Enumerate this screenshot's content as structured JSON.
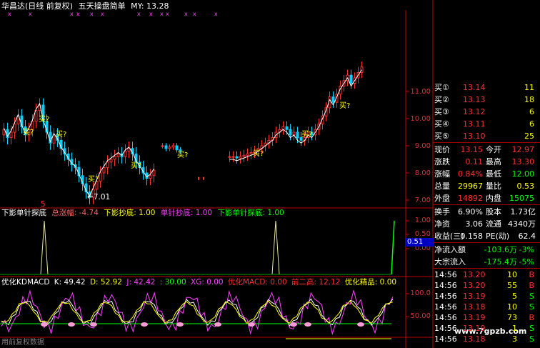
{
  "header": {
    "stock": "华昌达(日线 前复权)",
    "indicator": "五天操盘简单",
    "my": "MY: 13.28"
  },
  "main_axis": [
    "11.00",
    "10.00",
    "9.00",
    "8.00",
    "7.00"
  ],
  "price_labels": {
    "low": "7.01"
  },
  "buy_tags": [
    "买?",
    "买?",
    "买?",
    "买?",
    "买?",
    "买?",
    "买?",
    "买?",
    "买?"
  ],
  "red_marker": "5",
  "panel2": {
    "name": "下影单针探底",
    "zongzhangfu": "总涨幅: -4.74",
    "xiaying": "下影抄底: 1.00",
    "danzhen": "单针抄底: 1.00",
    "tandi": "下影单针探底: 1.00",
    "axis": [
      "1.00",
      "0.50",
      "0.00"
    ],
    "cursor": "0.51"
  },
  "panel3": {
    "name": "优化KDMACD",
    "k": "K: 49.42",
    "d": "D: 52.92",
    "j": "J: 42.42",
    "v30": ": 30.00",
    "xg": "XG: 0.00",
    "macd": "优化MACD: 0.00",
    "qianerao": "前二高: 12.12",
    "jingpin": "优化精品: 0.00",
    "axis": [
      "100.0",
      "50.00"
    ]
  },
  "footer": {
    "left": "用前复权数据",
    "watermark": "www.7gpzb.com"
  },
  "quote": {
    "buys": [
      {
        "label": "买①",
        "price": "13.14",
        "vol": "11"
      },
      {
        "label": "买②",
        "price": "13.13",
        "vol": "18"
      },
      {
        "label": "买③",
        "price": "13.12",
        "vol": "6"
      },
      {
        "label": "买④",
        "price": "13.11",
        "vol": "6"
      },
      {
        "label": "买⑤",
        "price": "13.10",
        "vol": "25"
      }
    ],
    "stats": [
      {
        "l1": "现价",
        "v1": "13.15",
        "l2": "今开",
        "v2": "12.97"
      },
      {
        "l1": "涨跌",
        "v1": "0.11",
        "l2": "最高",
        "v2": "13.30"
      },
      {
        "l1": "涨幅",
        "v1": "0.84%",
        "l2": "最低",
        "v2": "12.00"
      },
      {
        "l1": "总量",
        "v1": "29967",
        "l2": "量比",
        "v2": "0.53"
      },
      {
        "l1": "外盘",
        "v1": "14892",
        "l2": "内盘",
        "v2": "15075"
      }
    ],
    "finance": [
      {
        "l1": "换手",
        "v1": "6.90%",
        "l2": "股本",
        "v2": "1.73亿"
      },
      {
        "l1": "净资",
        "v1": "3.06",
        "l2": "流通",
        "v2": "4340万"
      },
      {
        "l1": "收益(三)",
        "v1": "0.158",
        "l2": "PE(动)",
        "v2": "62.4"
      }
    ],
    "flow": [
      {
        "label": "净流入额",
        "value": "-103.6万",
        "pct": "-3%"
      },
      {
        "label": "大宗流入",
        "value": "-175.4万",
        "pct": "-5%"
      }
    ],
    "ticks": [
      {
        "time": "14:56",
        "price": "13.20",
        "vol": "10",
        "side": "B"
      },
      {
        "time": "14:56",
        "price": "13.20",
        "vol": "55",
        "side": "B"
      },
      {
        "time": "14:56",
        "price": "13.19",
        "vol": "5",
        "side": "S"
      },
      {
        "time": "14:56",
        "price": "13.18",
        "vol": "10",
        "side": "S"
      },
      {
        "time": "14:56",
        "price": "13.19",
        "vol": "73",
        "side": "B"
      },
      {
        "time": "14:56",
        "price": "13.19",
        "vol": "1",
        "side": "S"
      },
      {
        "time": "14:56",
        "price": "13.18",
        "vol": "3",
        "side": "S"
      }
    ]
  },
  "colors": {
    "up": "#ff3030",
    "down": "#00d0ff",
    "ma": "#ffffff",
    "yellow": "#ffff00",
    "magenta": "#ff40ff",
    "green": "#00ff00",
    "axisred": "#c00000"
  }
}
